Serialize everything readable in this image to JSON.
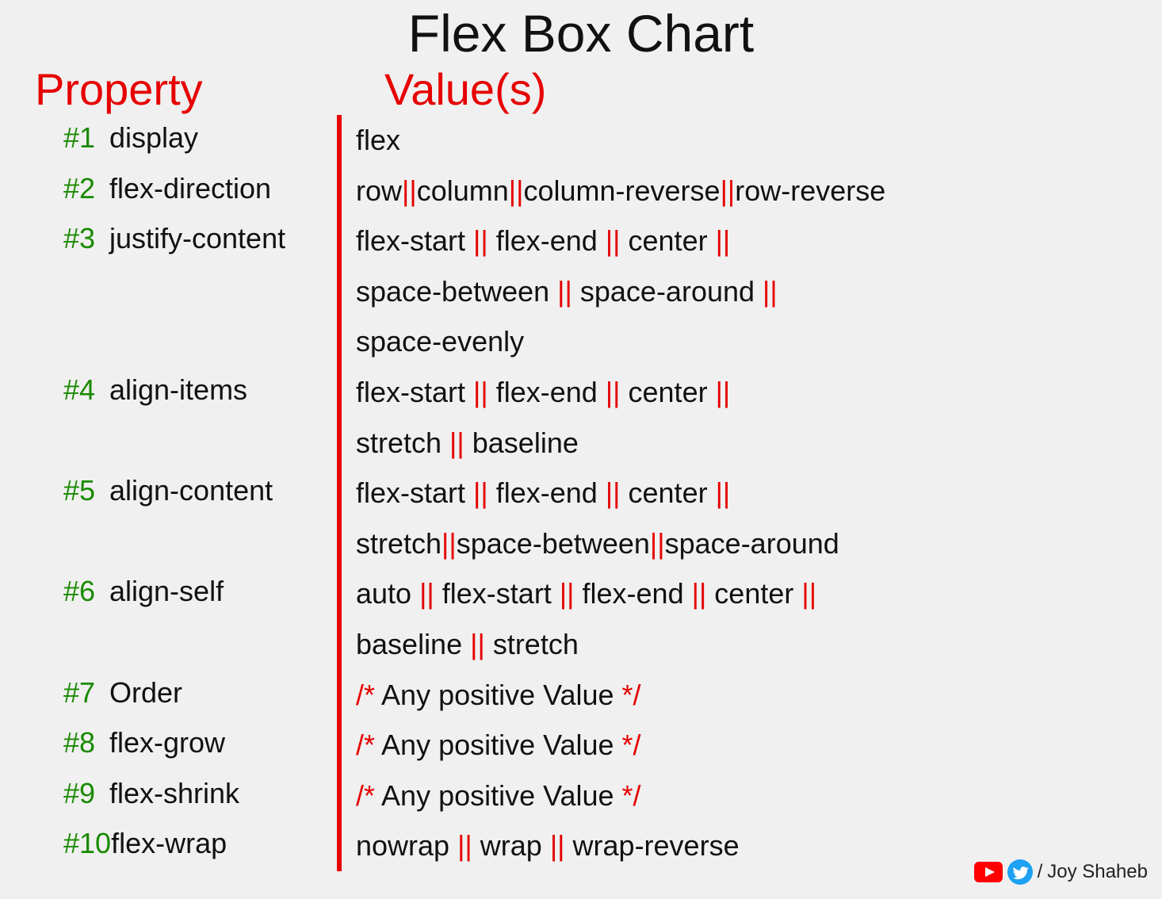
{
  "title": "Flex Box Chart",
  "headers": {
    "property": "Property",
    "value": "Value(s)"
  },
  "rows": [
    {
      "num": "#1",
      "prop": "display",
      "lines": [
        [
          {
            "t": "flex"
          }
        ]
      ]
    },
    {
      "num": "#2",
      "prop": "flex-direction",
      "lines": [
        [
          {
            "t": "row"
          },
          {
            "s": "||"
          },
          {
            "t": "column"
          },
          {
            "s": "||"
          },
          {
            "t": "column-reverse"
          },
          {
            "s": "||"
          },
          {
            "t": "row-reverse"
          }
        ]
      ]
    },
    {
      "num": "#3",
      "prop": "justify-content",
      "lines": [
        [
          {
            "t": "flex-start "
          },
          {
            "s": "||"
          },
          {
            "t": " flex-end "
          },
          {
            "s": "||"
          },
          {
            "t": " center "
          },
          {
            "s": "||"
          }
        ],
        [
          {
            "t": "space-between "
          },
          {
            "s": "||"
          },
          {
            "t": " space-around "
          },
          {
            "s": "||"
          }
        ],
        [
          {
            "t": "space-evenly"
          }
        ]
      ]
    },
    {
      "num": "#4",
      "prop": "align-items",
      "lines": [
        [
          {
            "t": "flex-start "
          },
          {
            "s": "||"
          },
          {
            "t": " flex-end "
          },
          {
            "s": "||"
          },
          {
            "t": " center "
          },
          {
            "s": "||"
          }
        ],
        [
          {
            "t": "stretch "
          },
          {
            "s": "||"
          },
          {
            "t": " baseline"
          }
        ]
      ]
    },
    {
      "num": "#5",
      "prop": "align-content",
      "lines": [
        [
          {
            "t": "flex-start "
          },
          {
            "s": "||"
          },
          {
            "t": " flex-end "
          },
          {
            "s": "||"
          },
          {
            "t": " center "
          },
          {
            "s": "||"
          }
        ],
        [
          {
            "t": "stretch"
          },
          {
            "s": "||"
          },
          {
            "t": "space-between"
          },
          {
            "s": "||"
          },
          {
            "t": "space-around"
          }
        ]
      ]
    },
    {
      "num": "#6",
      "prop": "align-self",
      "lines": [
        [
          {
            "t": "auto "
          },
          {
            "s": "||"
          },
          {
            "t": " flex-start "
          },
          {
            "s": "||"
          },
          {
            "t": " flex-end "
          },
          {
            "s": "||"
          },
          {
            "t": " center "
          },
          {
            "s": "||"
          }
        ],
        [
          {
            "t": "baseline "
          },
          {
            "s": "||"
          },
          {
            "t": " stretch"
          }
        ]
      ]
    },
    {
      "num": "#7",
      "prop": "Order",
      "lines": [
        [
          {
            "s": "/*"
          },
          {
            "t": " Any positive Value "
          },
          {
            "s": "*/"
          }
        ]
      ]
    },
    {
      "num": "#8",
      "prop": "flex-grow",
      "lines": [
        [
          {
            "s": "/*"
          },
          {
            "t": " Any positive Value "
          },
          {
            "s": "*/"
          }
        ]
      ]
    },
    {
      "num": "#9",
      "prop": "flex-shrink",
      "lines": [
        [
          {
            "s": "/*"
          },
          {
            "t": " Any positive Value "
          },
          {
            "s": "*/"
          }
        ]
      ]
    },
    {
      "num": "#10",
      "prop": "flex-wrap",
      "lines": [
        [
          {
            "t": "nowrap "
          },
          {
            "s": "||"
          },
          {
            "t": " wrap "
          },
          {
            "s": "||"
          },
          {
            "t": " wrap-reverse"
          }
        ]
      ]
    }
  ],
  "credit": {
    "slash": "/",
    "name": "Joy Shaheb"
  },
  "chart_data": {
    "type": "table",
    "title": "Flex Box Chart",
    "columns": [
      "Property",
      "Value(s)"
    ],
    "rows": [
      [
        "display",
        "flex"
      ],
      [
        "flex-direction",
        "row || column || column-reverse || row-reverse"
      ],
      [
        "justify-content",
        "flex-start || flex-end || center || space-between || space-around || space-evenly"
      ],
      [
        "align-items",
        "flex-start || flex-end || center || stretch || baseline"
      ],
      [
        "align-content",
        "flex-start || flex-end || center || stretch || space-between || space-around"
      ],
      [
        "align-self",
        "auto || flex-start || flex-end || center || baseline || stretch"
      ],
      [
        "Order",
        "/* Any positive Value */"
      ],
      [
        "flex-grow",
        "/* Any positive Value */"
      ],
      [
        "flex-shrink",
        "/* Any positive Value */"
      ],
      [
        "flex-wrap",
        "nowrap || wrap || wrap-reverse"
      ]
    ]
  }
}
